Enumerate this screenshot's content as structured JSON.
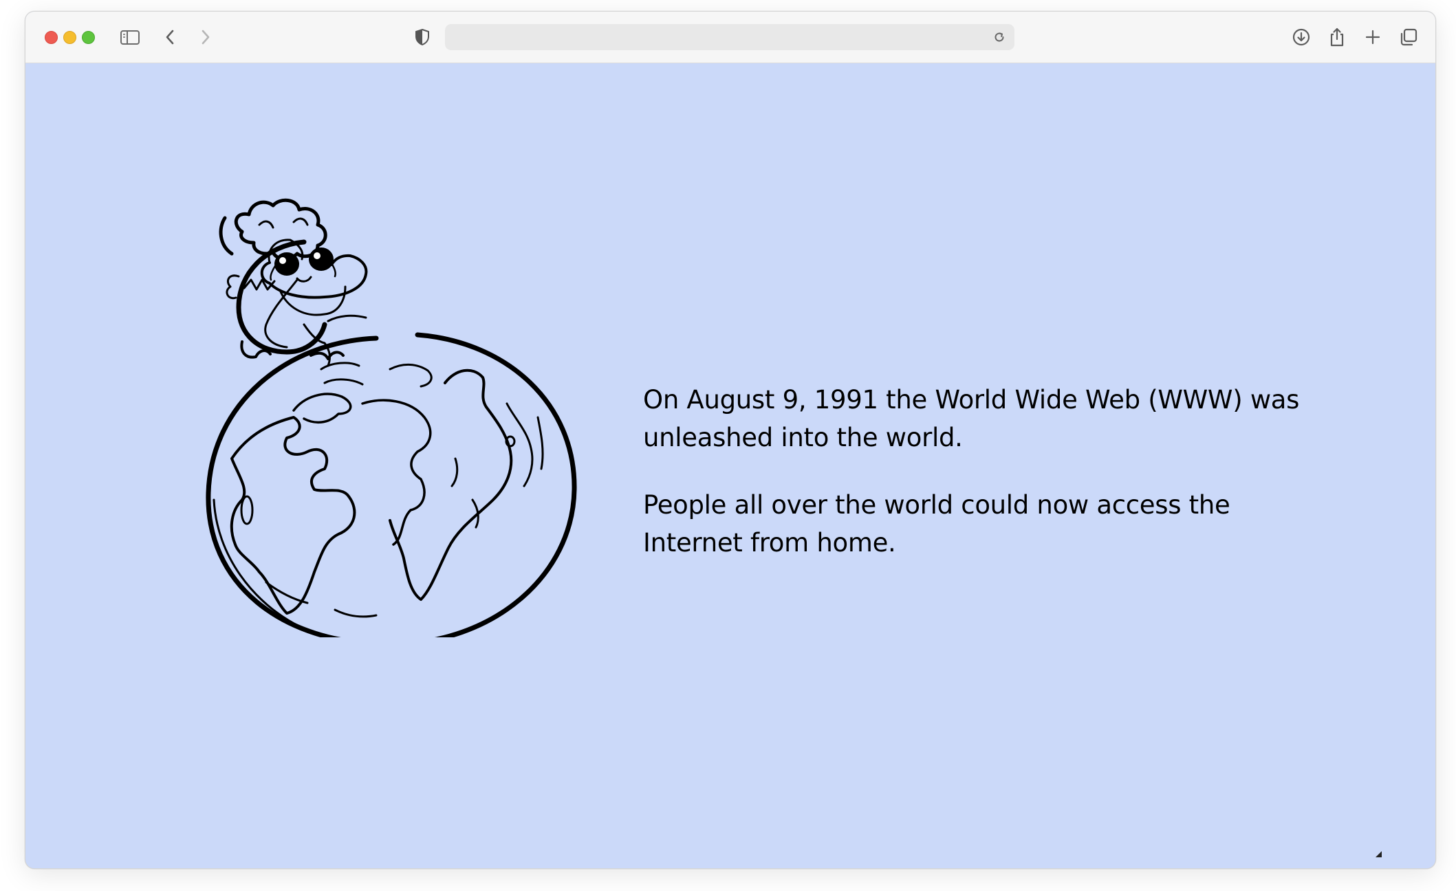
{
  "browser": {
    "address_bar": {
      "url": ""
    },
    "icons": {
      "sidebar": "sidebar-icon",
      "back": "chevron-left-icon",
      "forward": "chevron-right-icon",
      "privacy": "shield-icon",
      "reload": "reload-icon",
      "download": "download-icon",
      "share": "share-icon",
      "new_tab": "plus-icon",
      "tabs": "tab-overview-icon"
    },
    "colors": {
      "page_background": "#cbd9f9",
      "close": "#ee5b52",
      "minimize": "#f5bd2e",
      "maximize": "#5ec43e"
    }
  },
  "page": {
    "illustration": "cartoon-character-on-globe",
    "paragraphs": [
      "On August 9, 1991 the World Wide Web (WWW) was unleashed into the world.",
      "People all over the world could now access the Internet from home."
    ]
  }
}
